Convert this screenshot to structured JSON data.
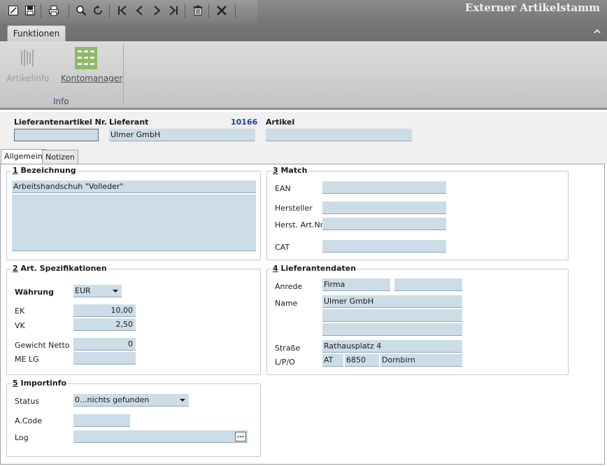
{
  "window": {
    "title": "Externer Artikelstamm"
  },
  "toolbar": {
    "buttons": [
      "edit-icon",
      "save-icon",
      "print-icon",
      "search-icon",
      "refresh-icon",
      "first-record-icon",
      "previous-record-icon",
      "next-record-icon",
      "last-record-icon",
      "delete-icon",
      "close-icon"
    ]
  },
  "ribbon": {
    "tab": "Funktionen",
    "group_label": "Info",
    "buttons": [
      {
        "label": "Artikelinfo",
        "enabled": false
      },
      {
        "label": "Kontomanager",
        "enabled": true
      }
    ]
  },
  "header": {
    "lieferantenartikel_label": "Lieferantenartikel Nr.",
    "lieferantenartikel_value": "",
    "lieferant_label": "Lieferant",
    "lieferant_nr": "10166",
    "lieferant_value": "Ulmer GmbH",
    "artikel_label": "Artikel",
    "artikel_value": ""
  },
  "tabs": [
    {
      "label": "Allgemein",
      "active": true
    },
    {
      "label": "Notizen",
      "active": false
    }
  ],
  "bezeichnung": {
    "num": "1",
    "title": " Bezeichnung",
    "line1": "Arbeitshandschuh \"Volleder\"",
    "text": ""
  },
  "match": {
    "num": "3",
    "title": " Match",
    "ean_label": "EAN",
    "ean": "",
    "hersteller_label": "Hersteller",
    "hersteller": "",
    "herst_artnr_label": "Herst. Art.Nr",
    "herst_artnr": "",
    "cat_label": "CAT",
    "cat": ""
  },
  "spezifikationen": {
    "num": "2",
    "title": " Art. Spezifikationen",
    "waehrung_label": "Währung",
    "waehrung": "EUR",
    "ek_label": "EK",
    "ek": "10,00",
    "vk_label": "VK",
    "vk": "2,50",
    "gewicht_label": "Gewicht Netto",
    "gewicht": "0",
    "me_label": "ME LG",
    "me": ""
  },
  "lieferantendaten": {
    "num": "4",
    "title": " Lieferantendaten",
    "anrede_label": "Anrede",
    "anrede": "Firma",
    "anrede2": "",
    "name_label": "Name",
    "name1": "Ulmer GmbH",
    "name2": "",
    "name3": "",
    "strasse_label": "Straße",
    "strasse": "Rathausplatz 4",
    "lpo_label": "L/P/O",
    "land": "AT",
    "plz": "6850",
    "ort": "Dornbirn"
  },
  "importinfo": {
    "num": "5",
    "title": " Importinfo",
    "status_label": "Status",
    "status": "0...nichts gefunden",
    "acode_label": "A.Code",
    "acode": "",
    "log_label": "Log",
    "log": "",
    "ellipsis": "..."
  },
  "colors": {
    "field_bg": "#ccdde8",
    "link_blue": "#1f3faa",
    "ribbon_group_label": "#3b4a78"
  }
}
